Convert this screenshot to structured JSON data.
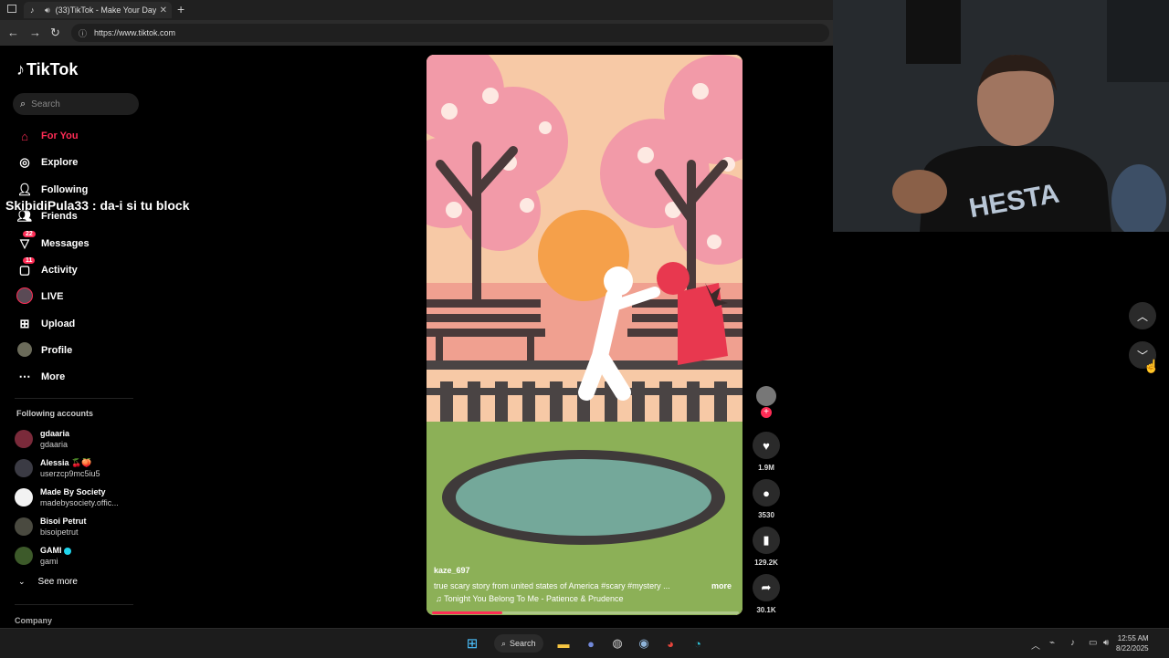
{
  "browser": {
    "tab_title": "(33)TikTok - Make Your Day",
    "url": "https://www.tiktok.com"
  },
  "sidebar": {
    "logo": "TikTok",
    "search_placeholder": "Search",
    "nav": [
      {
        "label": "For You",
        "icon": "home-icon"
      },
      {
        "label": "Explore",
        "icon": "compass-icon"
      },
      {
        "label": "Following",
        "icon": "user-follow-icon"
      },
      {
        "label": "Friends",
        "icon": "friends-icon"
      },
      {
        "label": "Messages",
        "icon": "messages-icon",
        "badge": "22"
      },
      {
        "label": "Activity",
        "icon": "activity-icon",
        "badge": "11"
      },
      {
        "label": "LIVE",
        "icon": "live-icon"
      },
      {
        "label": "Upload",
        "icon": "upload-icon"
      },
      {
        "label": "Profile",
        "icon": "profile-icon"
      },
      {
        "label": "More",
        "icon": "more-icon"
      }
    ],
    "following_title": "Following accounts",
    "accounts": [
      {
        "name": "gdaaria",
        "handle": "gdaaria"
      },
      {
        "name": "Alessia 🍒🍑",
        "handle": "userzcp9mc5iu5"
      },
      {
        "name": "Made By Society",
        "handle": "madebysociety.offic..."
      },
      {
        "name": "Bisoi Petrut",
        "handle": "bisoipetrut"
      },
      {
        "name": "GAMI",
        "handle": "gami"
      }
    ],
    "see_more": "See more",
    "company": "Company"
  },
  "overlay_chat": "SkibidiPula33 : da-i si tu block",
  "video": {
    "author": "kaze_697",
    "description": "true scary story from united states of America #scary  #mystery  ...",
    "more": "more",
    "music": "Tonight You Belong To Me - Patience & Prudence",
    "progress": 0.23
  },
  "actions": {
    "likes": "1.9M",
    "comments": "3530",
    "saves": "129.2K",
    "shares": "30.1K"
  },
  "taskbar": {
    "search_label": "Search",
    "time": "12:55 AM",
    "date": "8/22/2025"
  }
}
